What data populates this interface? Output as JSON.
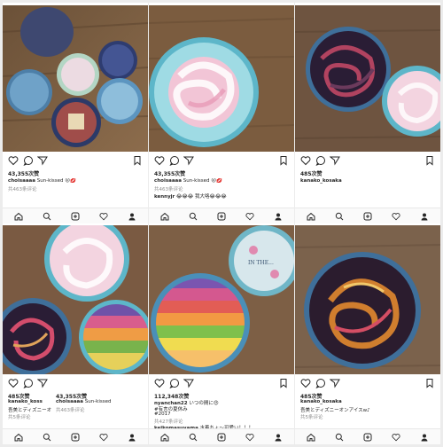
{
  "panels": [
    {
      "likes": "43,355次赞",
      "caption_user": "choisaaaa",
      "caption_text": "Sun-kissed 😜💋",
      "comments_link": "共463条评论",
      "extra_lines": []
    },
    {
      "likes": "43,355次赞",
      "caption_user": "choisaaaa",
      "caption_text": "Sun-kissed 😜💋",
      "comments_link": "共463条评论",
      "extra_lines": [
        {
          "user": "kennyjr",
          "text": "😂😂😂 我大咯😂😂😂"
        }
      ]
    },
    {
      "likes": "485次赞",
      "caption_user": "kanako_kosaka",
      "caption_text": "",
      "comments_link": "",
      "extra_lines": []
    },
    {
      "likes": "485次赞",
      "caption_user": "kanako_koss",
      "caption_text": "",
      "comments_link": "",
      "extra_lines": [
        {
          "user": "",
          "text": "吾美とディズニーオンアイスw♪ …更多"
        },
        {
          "user": "",
          "text": "共5条评论"
        }
      ]
    },
    {
      "likes": "112,348次赞",
      "caption_user": "nyanchan22",
      "caption_text": "いつの間に😍",
      "comments_link": "",
      "extra_lines": [
        {
          "user": "",
          "text": "#有言の夏休み"
        },
        {
          "user": "",
          "text": "#2017"
        },
        {
          "user": "",
          "text": "共427条评论"
        },
        {
          "user": "keikomasuyama",
          "text": "水着ちょ〜可愛い！！！"
        }
      ]
    },
    {
      "likes": "485次赞",
      "caption_user": "kanako_kosaka",
      "caption_text": "",
      "comments_link": "",
      "extra_lines": [
        {
          "user": "",
          "text": "吾美とディズニーオンアイスw♪"
        },
        {
          "user": "",
          "text": "共5条评论"
        }
      ]
    }
  ],
  "overlay_panel4": {
    "likes": "43,355次赞",
    "caption_user": "choisaaaa",
    "caption_text": "Sun-kissed",
    "comments_link": "共463条评论"
  },
  "tin_label": "IN THE...",
  "icons": {
    "like": "heart-icon",
    "comment": "comment-icon",
    "share": "share-icon",
    "save": "bookmark-icon",
    "nav": [
      "home-icon",
      "search-icon",
      "add-post-icon",
      "activity-icon",
      "profile-icon"
    ]
  }
}
